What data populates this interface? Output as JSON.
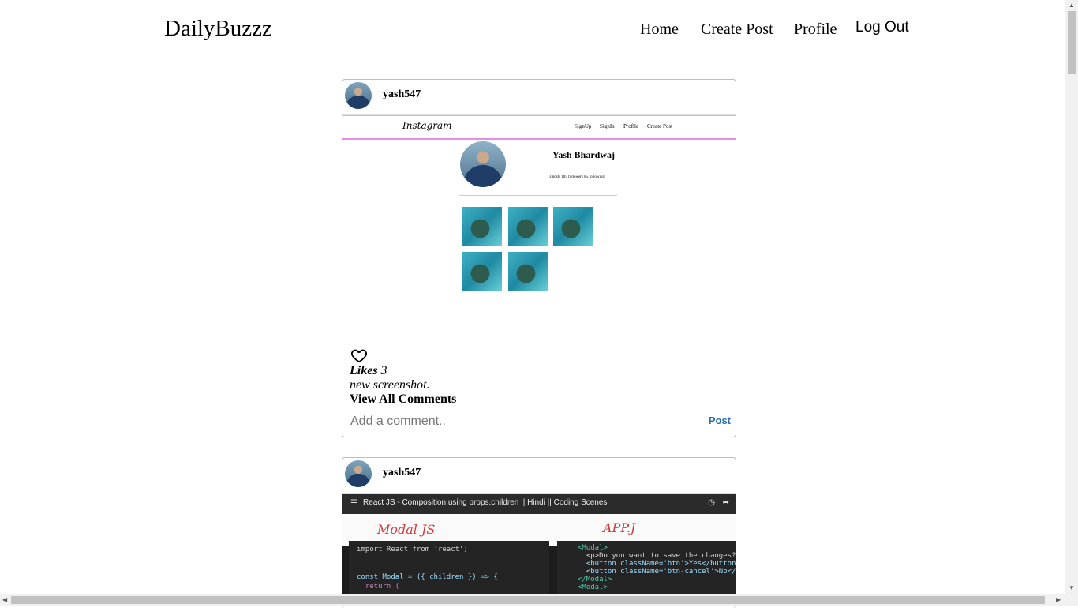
{
  "nav": {
    "brand": "DailyBuzzz",
    "home": "Home",
    "create_post": "Create Post",
    "profile": "Profile",
    "logout": "Log Out"
  },
  "posts": [
    {
      "username": "yash547",
      "image_content": {
        "logo": "Instagram",
        "links": [
          "SignUp",
          "SignIn",
          "Profile",
          "Create Post"
        ],
        "profile_name": "Yash Bhardwaj",
        "stats": "3 posts   105 followers   85 following"
      },
      "likes_label": "Likes",
      "likes_count": "3",
      "caption": "new screenshot.",
      "view_comments": "View All Comments",
      "comment_placeholder": "Add a comment..",
      "post_label": "Post"
    },
    {
      "username": "yash547",
      "video": {
        "title": "React JS - Composition using props.children || Hindi || Coding Scenes",
        "annotation_left": "Modal JS",
        "annotation_right": "APP.J",
        "code_left": [
          "import React from 'react';",
          "",
          "const Modal = ({ children }) => {",
          "  return ("
        ],
        "code_right": [
          "<Modal>",
          "  <p>Do you want to save the changes?</p>",
          "  <button className='btn'>Yes</button>",
          "  <button className='btn-cancel'>No</button>",
          "</Modal>",
          "<Modal>"
        ]
      }
    }
  ]
}
